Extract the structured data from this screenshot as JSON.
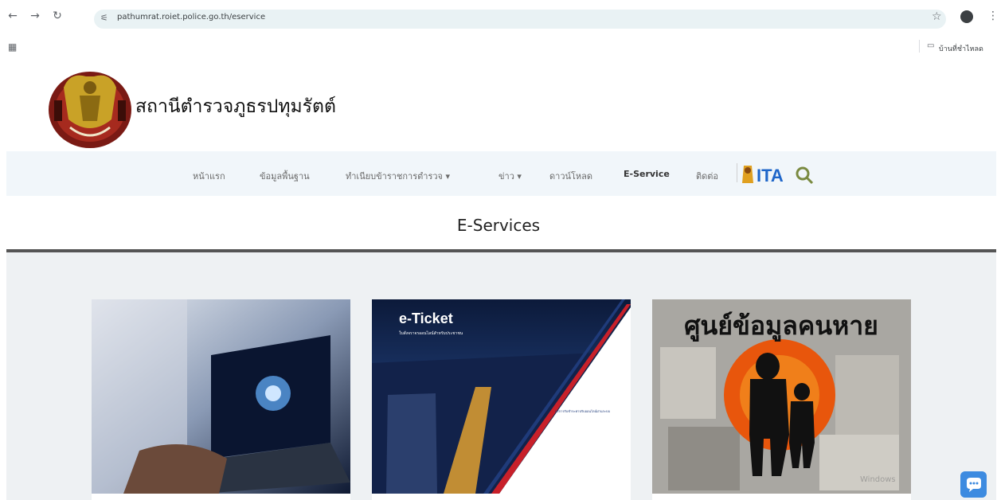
{
  "browser": {
    "url": "pathumrat.roiet.police.go.th/eservice",
    "bookmark_folder_label": "บ้านที่ชำไหลด"
  },
  "site": {
    "title": "สถานีตำรวจภูธรปทุมรัตต์"
  },
  "nav": {
    "items": [
      {
        "label": "หน้าแรก"
      },
      {
        "label": "ข้อมูลพื้นฐาน"
      },
      {
        "label": "ทำเนียบข้าราชการตำรวจ ▾"
      },
      {
        "label": "ข่าว ▾"
      },
      {
        "label": "ดาวน์โหลด"
      },
      {
        "label": "E-Service"
      },
      {
        "label": "ติดต่อ"
      }
    ],
    "ita_label": "ITA"
  },
  "page": {
    "heading": "E-Services"
  },
  "cards": [
    {
      "image": "laptop-security"
    },
    {
      "image": "e-ticket",
      "title": "e-Ticket",
      "subtitle": "ใบสั่งจราจรออนไลน์สำหรับประชาชน",
      "note": "บริการรับชำระค่าปรับออนไลน์ผ่านระบบ"
    },
    {
      "image": "missing-persons",
      "title": "ศูนย์ข้อมูลคนหาย",
      "watermark": "Windows"
    }
  ],
  "colors": {
    "navbar_bg": "#f1f6fa",
    "content_bg": "#eef1f3",
    "chat_button": "#3d8be0"
  }
}
